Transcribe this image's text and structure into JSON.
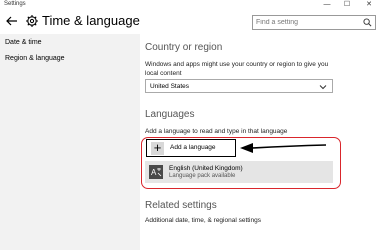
{
  "window": {
    "title": "Settings",
    "controls": {
      "minimize": "—",
      "maximize": "☐",
      "close": "✕"
    }
  },
  "header": {
    "title": "Time & language",
    "search_placeholder": "Find a setting"
  },
  "sidebar": {
    "items": [
      {
        "label": "Date & time"
      },
      {
        "label": "Region & language"
      }
    ]
  },
  "country": {
    "heading": "Country or region",
    "description": "Windows and apps might use your country or region to give you local content",
    "selected": "United States"
  },
  "languages": {
    "heading": "Languages",
    "description": "Add a language to read and type in that language",
    "add_label": "Add a language",
    "items": [
      {
        "name": "English (United Kingdom)",
        "status": "Language pack available"
      }
    ]
  },
  "related": {
    "heading": "Related settings",
    "link": "Additional date, time, & regional settings"
  },
  "colors": {
    "highlight_frame": "#d9262c",
    "sidebar_bg": "#f2f2f2",
    "list_item_bg": "#e5e5e5"
  }
}
